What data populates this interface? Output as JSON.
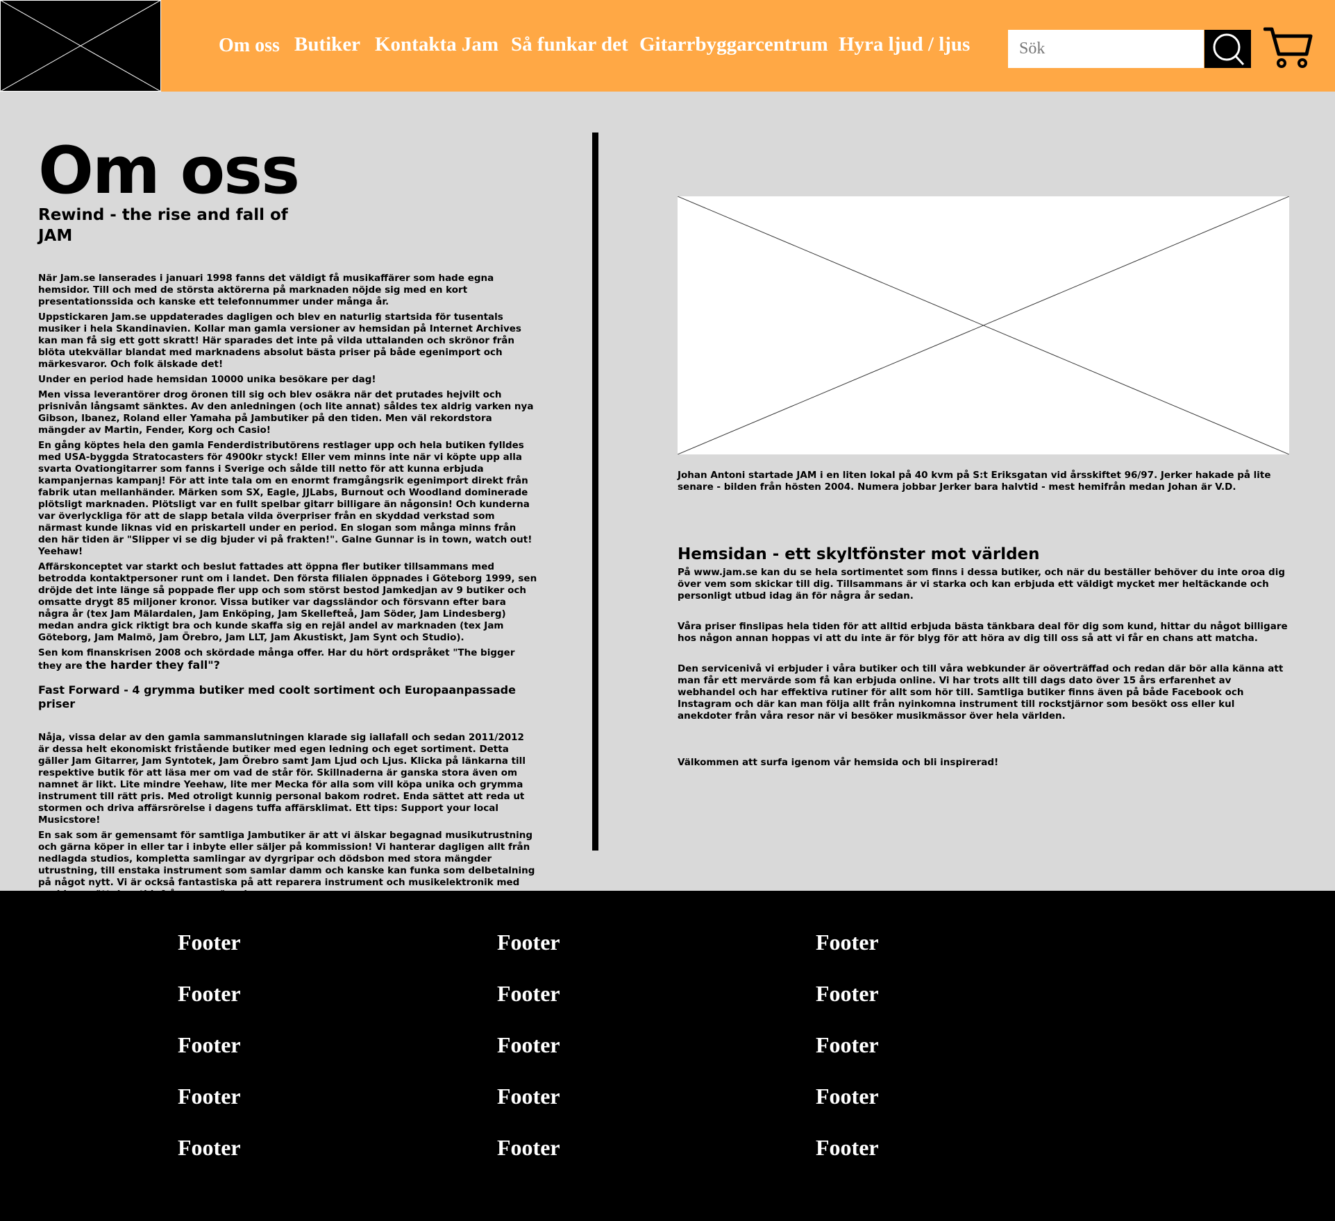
{
  "header": {
    "brand_color": "#ffa845",
    "logo_icon": "logo-placeholder-icon",
    "nav": [
      {
        "label": "Om oss"
      },
      {
        "label": "Butiker"
      },
      {
        "label": "Kontakta Jam"
      },
      {
        "label": "Så funkar det"
      },
      {
        "label": "Gitarrbyggarcentrum"
      },
      {
        "label": "Hyra ljud / ljus"
      }
    ],
    "search": {
      "placeholder": "Sök",
      "value": "",
      "icon": "search-icon"
    },
    "cart": {
      "icon": "cart-icon"
    }
  },
  "main": {
    "title": "Om oss",
    "subtitle": "Rewind - the rise and fall of JAM",
    "left": {
      "paragraphs": [
        "När Jam.se lanserades i januari 1998 fanns det väldigt få musikaffärer som hade egna hemsidor. Till och med de största aktörerna på marknaden nöjde sig med en kort presentationssida och kanske ett telefonnummer under många år.",
        "Uppstickaren Jam.se uppdaterades dagligen och blev en naturlig startsida för tusentals musiker i hela Skandinavien. Kollar man gamla versioner av hemsidan på Internet Archives kan man få sig ett gott skratt! Här sparades det inte på vilda uttalanden och skrönor från blöta utekvällar blandat med marknadens absolut bästa priser på både egenimport och märkesvaror. Och folk älskade det!",
        "Under en period hade hemsidan 10000 unika besökare per dag!",
        "Men vissa leverantörer drog öronen till sig och blev osäkra när det prutades hejvilt och prisnivån långsamt sänktes. Av den anledningen (och lite annat) såldes tex aldrig varken nya Gibson, Ibanez, Roland eller Yamaha på Jambutiker på den tiden. Men väl rekordstora mängder av Martin, Fender, Korg och Casio!",
        "En gång köptes hela den gamla Fenderdistributörens restlager upp och hela butiken fylldes med USA-byggda Stratocasters för 4900kr styck! Eller vem minns inte när vi köpte upp alla svarta Ovationgitarrer som fanns i Sverige och sålde till netto för att kunna erbjuda kampanjernas kampanj! För att inte tala om en enormt framgångsrik egenimport direkt från fabrik utan mellanhänder. Märken som SX, Eagle, JJLabs, Burnout och Woodland dominerade plötsligt marknaden. Plötsligt var en fullt spelbar gitarr billigare än någonsin! Och kunderna var överlyckliga för att de slapp betala vilda överpriser från en skyddad verkstad som närmast kunde liknas vid en priskartell under en period. En slogan som många minns från den här tiden är \"Slipper vi se dig bjuder vi på frakten!\". Galne Gunnar is in town, watch out! Yeehaw!",
        "Affärskonceptet var starkt och beslut fattades att öppna fler butiker tillsammans med betrodda kontaktpersoner runt om i landet. Den första filialen öppnades i Göteborg 1999, sen dröjde det inte länge så poppade fler upp och som störst bestod Jamkedjan av 9 butiker och omsatte drygt 85 miljoner kronor. Vissa butiker var dagssländor och försvann efter bara några år (tex Jam Mälardalen, Jam Enköping, Jam Skellefteå, Jam Söder, Jam Lindesberg) medan andra gick riktigt bra och kunde skaffa sig en rejäl andel av marknaden (tex Jam Göteborg, Jam Malmö, Jam Örebro, Jam LLT, Jam Akustiskt, Jam Synt och Studio)."
      ],
      "crisis_start": "Sen kom finanskrisen 2008 och skördade många offer. Har du hört ordspråket \"The bigger they are",
      "crisis_end": "the harder they fall\"?",
      "forward_heading": "Fast Forward - 4 grymma butiker med coolt sortiment och Europaanpassade priser",
      "forward_paragraphs": [
        "Nåja, vissa delar av den gamla sammanslutningen klarade sig iallafall och sedan 2011/2012 är dessa helt ekonomiskt fristående butiker med egen ledning och eget sortiment. Detta gäller Jam Gitarrer, Jam Syntotek, Jam Örebro samt Jam Ljud och Ljus. Klicka på länkarna till respektive butik för att läsa mer om vad de står för. Skillnaderna är ganska stora även om namnet är likt. Lite mindre Yeehaw, lite mer Mecka för alla som vill köpa unika och grymma instrument till rätt pris. Med otroligt kunnig personal bakom rodret. Enda sättet att reda ut stormen och driva affärsrörelse i dagens tuffa affärsklimat. Ett tips: Support your local Musicstore!",
        "En sak som är gemensamt för samtliga Jambutiker är att vi älskar begagnad musikutrustning och gärna köper in eller tar i inbyte eller säljer på kommission! Vi hanterar dagligen allt från nedlagda studios, kompletta samlingar av dyrgripar och dödsbon med stora mängder utrustning, till enstaka instrument som samlar damm och kanske kan funka som delbetalning på något nytt. Vi är också fantastiska på att reparera instrument och musikelektronik med snabb omsättningstid, fråga oss gärna!"
      ]
    },
    "right": {
      "image_icon": "image-placeholder-icon",
      "caption": "Johan Antoni startade JAM i en liten lokal på 40 kvm på S:t Eriksgatan vid årsskiftet 96/97. Jerker hakade på lite senare - bilden från hösten 2004. Numera jobbar Jerker bara halvtid - mest hemifrån medan Johan är V.D.",
      "heading": "Hemsidan - ett skyltfönster mot världen",
      "paragraphs": [
        "På www.jam.se kan du se hela sortimentet som finns i dessa butiker, och när du beställer behöver du inte oroa dig över vem som skickar till dig. Tillsammans är vi starka och kan erbjuda ett väldigt mycket mer heltäckande och personligt utbud idag än för några år sedan.",
        "Våra priser finslipas hela tiden för att alltid erbjuda bästa tänkbara deal för dig som kund, hittar du något billigare hos någon annan hoppas vi att du inte är för blyg för att höra av dig till oss så att vi får en chans att matcha.",
        "Den servicenivå vi erbjuder i våra butiker och till våra webkunder är oöverträffad och redan där bör alla känna att man får ett mervärde som få kan erbjuda online. Vi har trots allt till dags dato över 15 års erfarenhet av webhandel och har effektiva rutiner för allt som hör till. Samtliga butiker finns även på både Facebook och Instagram och där kan man följa allt från nyinkomna instrument till rockstjärnor som besökt oss eller kul anekdoter från våra resor när vi besöker musikmässor över hela världen."
      ],
      "welcome": "Välkommen att surfa igenom vår hemsida och bli inspirerad!"
    }
  },
  "footer": {
    "columns": [
      [
        "Footer",
        "Footer",
        "Footer",
        "Footer",
        "Footer"
      ],
      [
        "Footer",
        "Footer",
        "Footer",
        "Footer",
        "Footer"
      ],
      [
        "Footer",
        "Footer",
        "Footer",
        "Footer",
        "Footer"
      ]
    ]
  }
}
